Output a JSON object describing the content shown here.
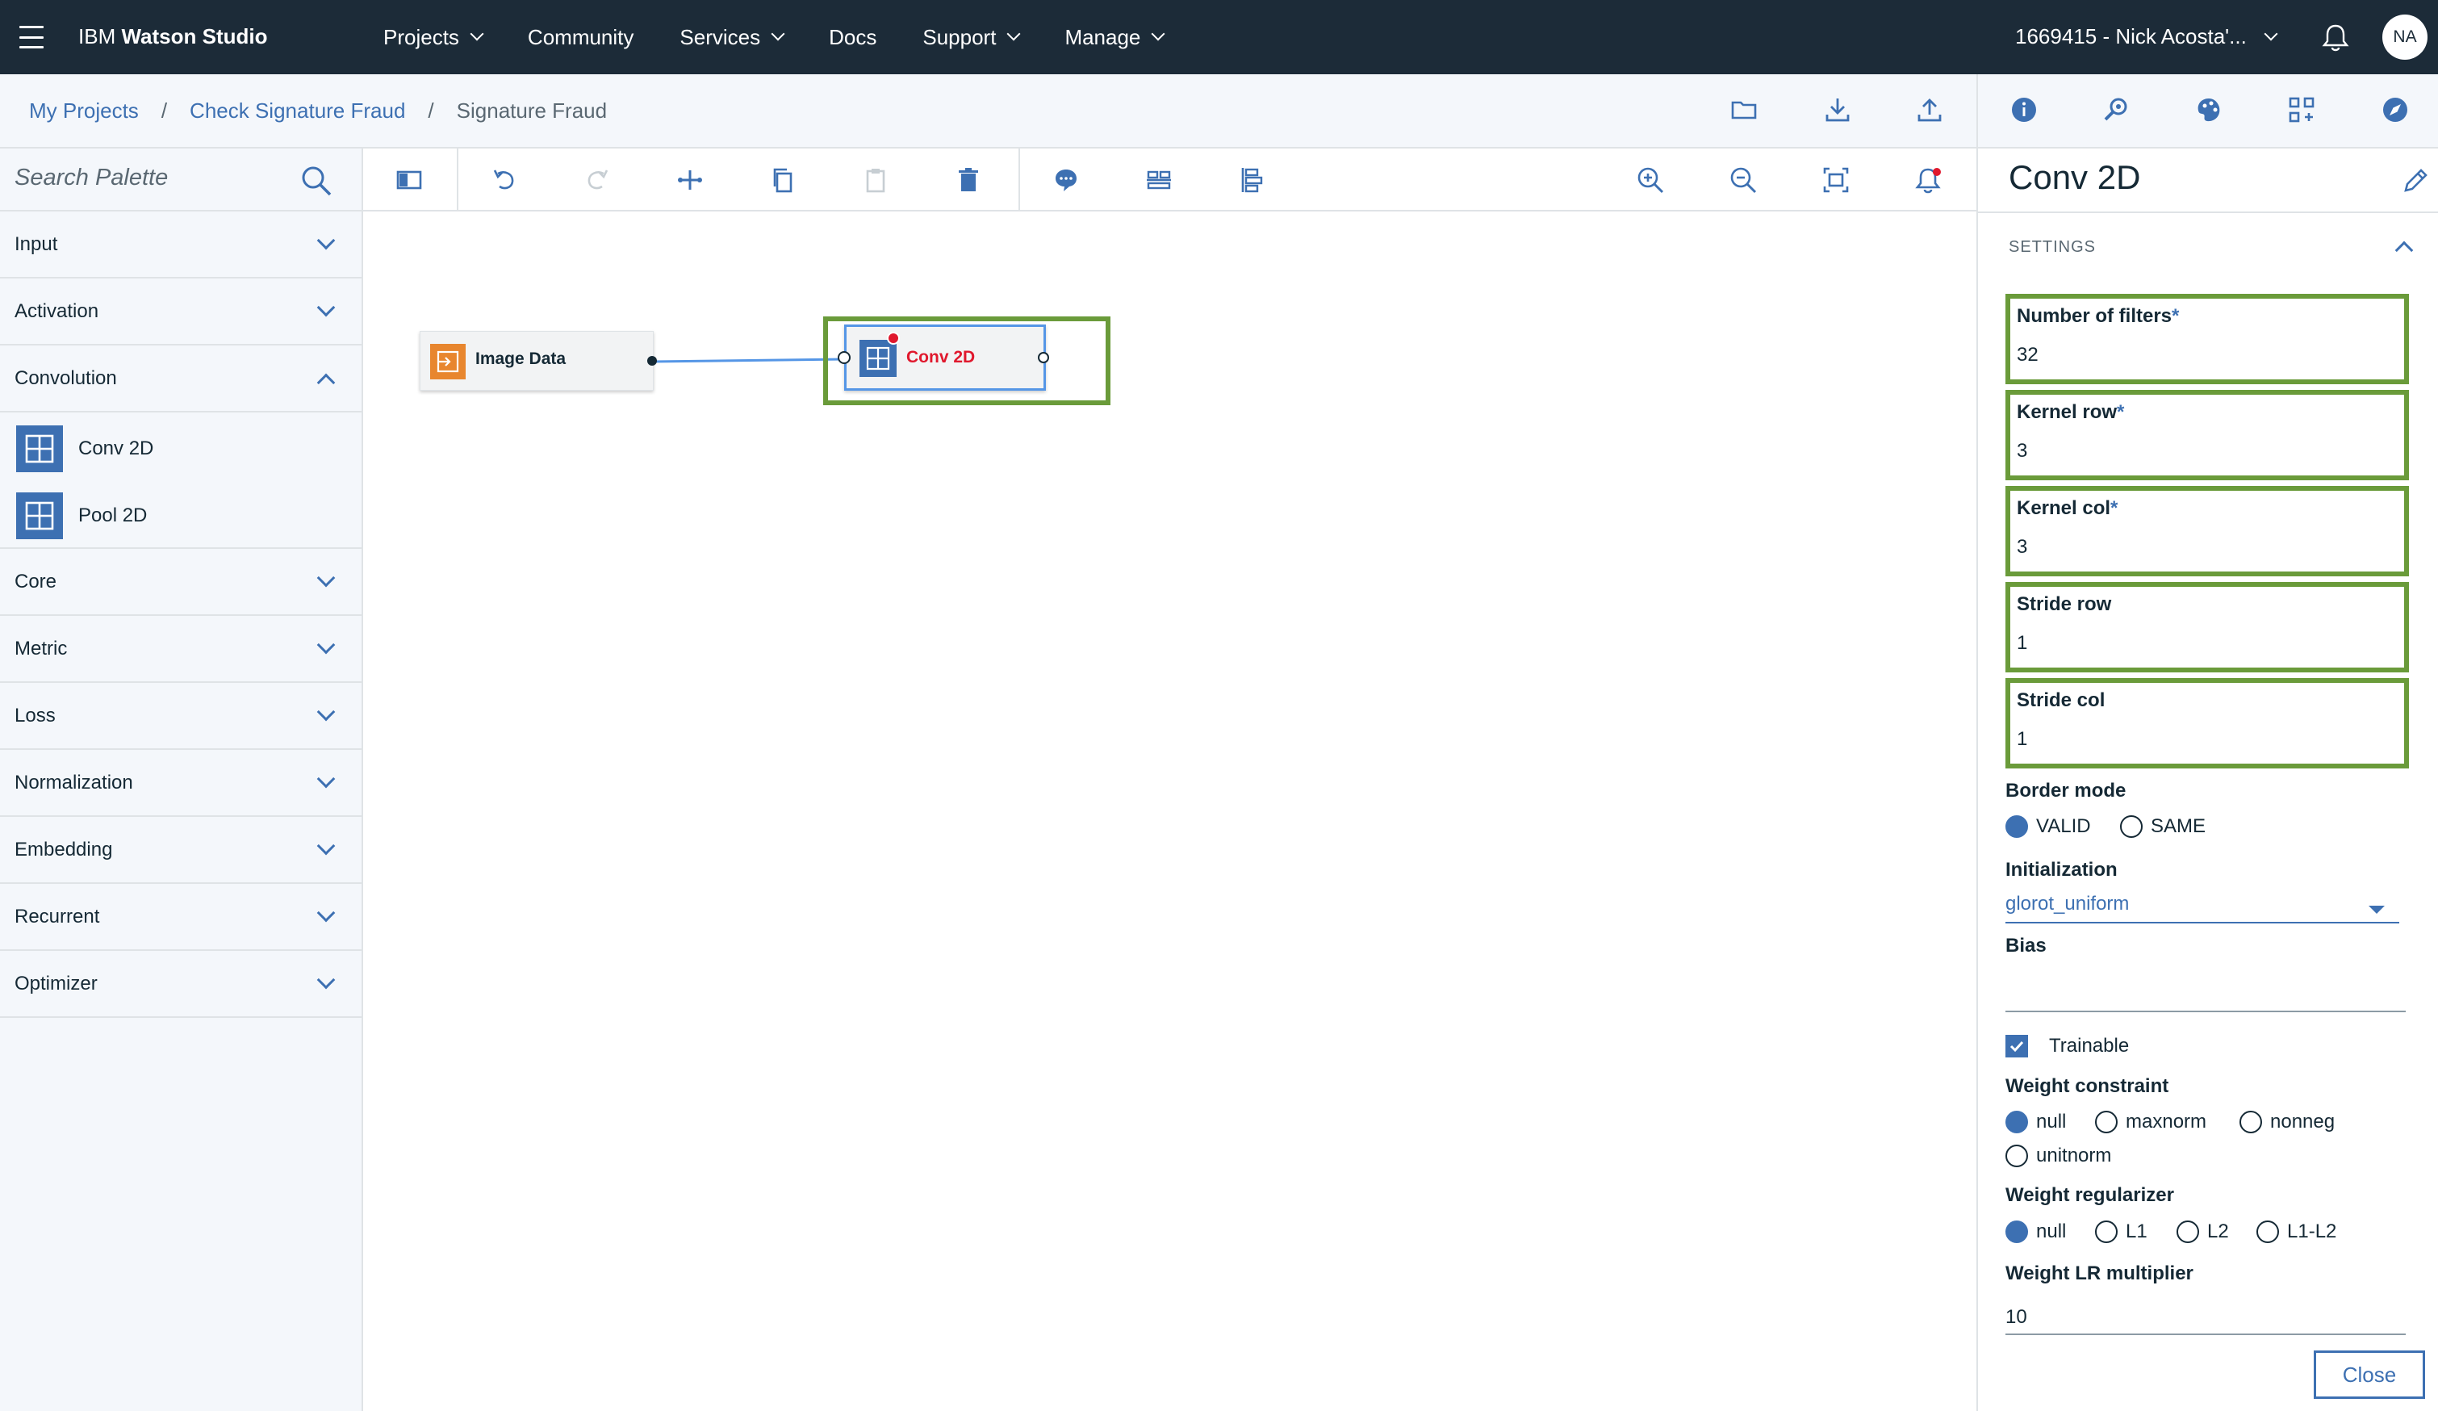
{
  "topnav": {
    "brand_prefix": "IBM",
    "brand_product": "Watson Studio",
    "menu": [
      {
        "label": "Projects",
        "has_dropdown": true
      },
      {
        "label": "Community",
        "has_dropdown": false
      },
      {
        "label": "Services",
        "has_dropdown": true
      },
      {
        "label": "Docs",
        "has_dropdown": false
      },
      {
        "label": "Support",
        "has_dropdown": true
      },
      {
        "label": "Manage",
        "has_dropdown": true
      }
    ],
    "account_label": "1669415 - Nick Acosta'...",
    "avatar_initials": "NA",
    "icons": [
      "menu-icon",
      "notification-bell-icon"
    ]
  },
  "breadcrumb": {
    "items": [
      "My Projects",
      "Check Signature Fraud"
    ],
    "separator": "/",
    "current": "Signature Fraud",
    "actions": [
      "folder-icon",
      "download-icon",
      "upload-icon"
    ]
  },
  "panel_tabs": [
    "info-icon",
    "search-settings-icon",
    "palette-icon",
    "flow-icon",
    "compass-icon"
  ],
  "palette": {
    "search_placeholder": "Search Palette",
    "categories": [
      {
        "label": "Input",
        "expanded": false
      },
      {
        "label": "Activation",
        "expanded": false
      },
      {
        "label": "Convolution",
        "expanded": true,
        "items": [
          "Conv 2D",
          "Pool 2D"
        ]
      },
      {
        "label": "Core",
        "expanded": false
      },
      {
        "label": "Metric",
        "expanded": false
      },
      {
        "label": "Loss",
        "expanded": false
      },
      {
        "label": "Normalization",
        "expanded": false
      },
      {
        "label": "Embedding",
        "expanded": false
      },
      {
        "label": "Recurrent",
        "expanded": false
      },
      {
        "label": "Optimizer",
        "expanded": false
      }
    ]
  },
  "toolbar": {
    "tools": [
      "toggle-palette-icon",
      "undo-icon",
      "redo-icon",
      "arrange-icon",
      "copy-icon",
      "paste-icon",
      "delete-icon",
      "comment-icon",
      "align-horizontal-icon",
      "align-vertical-icon",
      "zoom-in-icon",
      "zoom-out-icon",
      "fit-to-screen-icon",
      "notifications-icon"
    ]
  },
  "canvas": {
    "nodes": [
      {
        "label": "Image Data",
        "icon": "import-icon",
        "color": "#e8862e"
      },
      {
        "label": "Conv 2D",
        "icon": "grid-icon",
        "color": "#3d70b2",
        "has_error": true,
        "selected": true
      }
    ],
    "links": [
      {
        "from": "Image Data",
        "to": "Conv 2D"
      }
    ]
  },
  "properties": {
    "title": "Conv 2D",
    "section": "SETTINGS",
    "fields": [
      {
        "label": "Number of filters",
        "required": true,
        "value": "32"
      },
      {
        "label": "Kernel row",
        "required": true,
        "value": "3"
      },
      {
        "label": "Kernel col",
        "required": true,
        "value": "3"
      },
      {
        "label": "Stride row",
        "required": false,
        "value": "1"
      },
      {
        "label": "Stride col",
        "required": false,
        "value": "1"
      }
    ],
    "required_marker": "*",
    "border_mode": {
      "label": "Border mode",
      "options": [
        "VALID",
        "SAME"
      ],
      "selected": "VALID"
    },
    "initialization": {
      "label": "Initialization",
      "value": "glorot_uniform"
    },
    "bias": {
      "label": "Bias",
      "value": ""
    },
    "trainable": {
      "label": "Trainable",
      "checked": true
    },
    "weight_constraint": {
      "label": "Weight constraint",
      "options": [
        "null",
        "maxnorm",
        "nonneg",
        "unitnorm"
      ],
      "selected": "null"
    },
    "weight_regularizer": {
      "label": "Weight regularizer",
      "options": [
        "null",
        "L1",
        "L2",
        "L1-L2"
      ],
      "selected": "null"
    },
    "weight_lr_multiplier": {
      "label": "Weight LR multiplier",
      "value": "10"
    },
    "close_label": "Close"
  },
  "colors": {
    "nav_bg": "#1c2b38",
    "accent": "#3d70b2",
    "highlight": "#6a9b3a",
    "error": "#e0182d",
    "input_node": "#e8862e"
  }
}
